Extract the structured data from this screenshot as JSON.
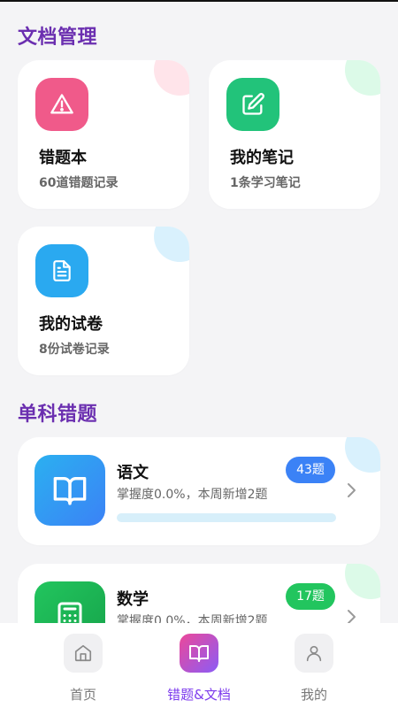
{
  "sections": {
    "docs_title": "文档管理",
    "subjects_title": "单科错题"
  },
  "doc_cards": [
    {
      "title": "错题本",
      "subtitle": "60道错题记录",
      "icon": "warning-triangle-icon",
      "accent": "#f05a8a",
      "corner_color": "#ffe4ea"
    },
    {
      "title": "我的笔记",
      "subtitle": "1条学习笔记",
      "icon": "edit-pencil-icon",
      "accent": "#22c37a",
      "corner_color": "#dcfae8"
    },
    {
      "title": "我的试卷",
      "subtitle": "8份试卷记录",
      "icon": "document-icon",
      "accent": "#2aa9f0",
      "corner_color": "#d9f1fd"
    }
  ],
  "subjects": [
    {
      "name": "语文",
      "meta": "掌握度0.0%，本周新增2题",
      "count": "43题",
      "icon": "open-book-icon",
      "badge_color": "#3b82f6",
      "corner_color": "#d9f1fd",
      "mastery_pct": 0.0
    },
    {
      "name": "数学",
      "meta": "掌握度0.0%，本周新增2题",
      "count": "17题",
      "icon": "calculator-icon",
      "badge_color": "#22c55e",
      "corner_color": "#dcfae8",
      "mastery_pct": 0.0
    }
  ],
  "nav": [
    {
      "label": "首页",
      "icon": "home-icon"
    },
    {
      "label": "错题&文档",
      "icon": "book-icon",
      "active": true
    },
    {
      "label": "我的",
      "icon": "user-icon"
    }
  ],
  "colors": {
    "section_title": "#6b2fb0",
    "background": "#f4f4f6",
    "active_nav": "#7c3aed"
  }
}
